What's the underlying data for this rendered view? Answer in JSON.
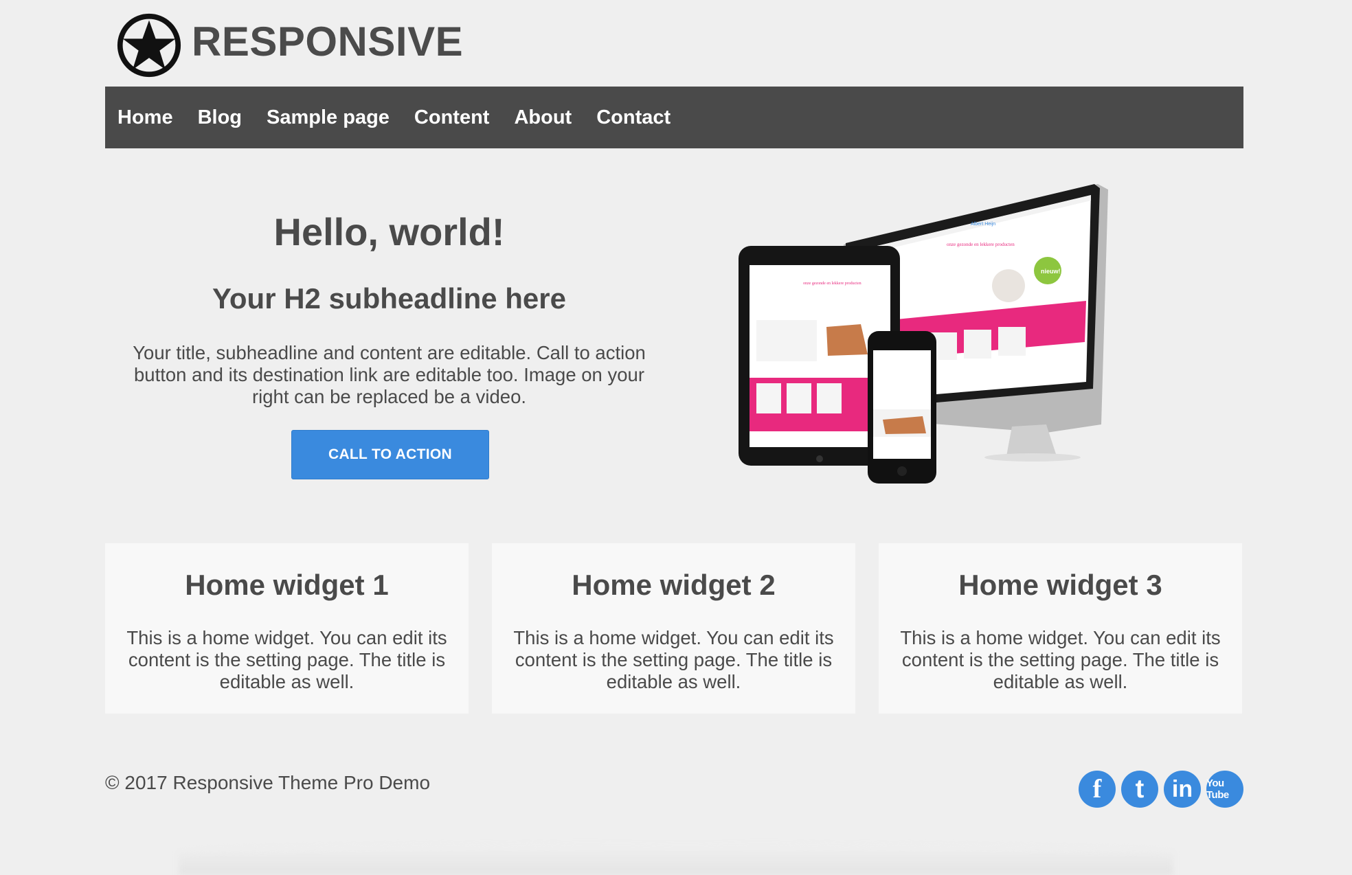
{
  "site": {
    "title": "RESPONSIVE",
    "logo_icon": "star-in-circle-icon"
  },
  "nav": {
    "items": [
      {
        "label": "Home"
      },
      {
        "label": "Blog"
      },
      {
        "label": "Sample page"
      },
      {
        "label": "Content"
      },
      {
        "label": "About"
      },
      {
        "label": "Contact"
      }
    ]
  },
  "hero": {
    "title": "Hello, world!",
    "subtitle": "Your H2 subheadline here",
    "text": "Your title, subheadline and content are editable. Call to action button and its destination link are editable too. Image on your right can be replaced be a video.",
    "cta_label": "CALL TO ACTION",
    "image": "responsive-devices-image",
    "image_texts": {
      "brand": "Albert Heijn",
      "tagline": "onze gezonde en lekkere producten",
      "badge": "nieuw!"
    }
  },
  "widgets": [
    {
      "title": "Home widget 1",
      "text": "This is a home widget. You can edit its content is the setting page. The title is editable as well."
    },
    {
      "title": "Home widget 2",
      "text": "This is a home widget. You can edit its content is the setting page. The title is editable as well."
    },
    {
      "title": "Home widget 3",
      "text": "This is a home widget. You can edit its content is the setting page. The title is editable as well."
    }
  ],
  "footer": {
    "copyright": "© 2017 Responsive Theme Pro Demo",
    "social": [
      {
        "icon": "facebook-icon",
        "glyph": "f"
      },
      {
        "icon": "twitter-icon",
        "glyph": "t"
      },
      {
        "icon": "linkedin-icon",
        "glyph": "in"
      },
      {
        "icon": "youtube-icon",
        "glyph": "You Tube"
      }
    ]
  },
  "colors": {
    "accent": "#3a8ade",
    "nav_bg": "#4a4a4a",
    "page_bg": "#efefef",
    "widget_bg": "#f8f8f8",
    "text": "#4a4a4a",
    "image_accent": "#e8297e"
  }
}
